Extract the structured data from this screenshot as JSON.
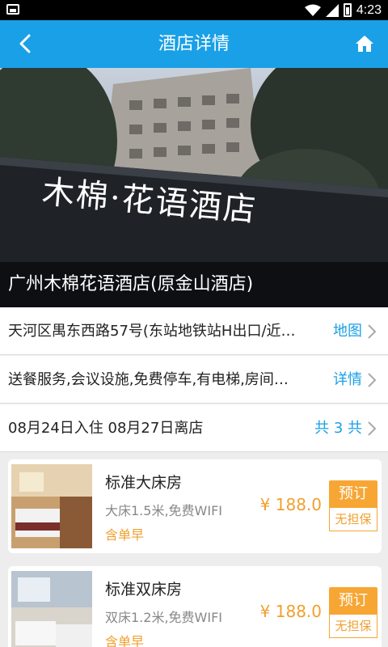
{
  "status_bar": {
    "time": "4:23"
  },
  "app_bar": {
    "title": "酒店详情"
  },
  "hotel": {
    "name": "广州木棉花语酒店(原金山酒店)",
    "sign_text": "木棉·花语酒店",
    "address": "天河区禺东西路57号(东站地铁站H出口/近…",
    "address_action": "地图",
    "facilities": "送餐服务,会议设施,免费停车,有电梯,房间…",
    "facilities_action": "详情",
    "stay": "08月24日入住 08月27日离店",
    "nights": "共 3 共"
  },
  "rooms": [
    {
      "name": "标准大床房",
      "bed": "大床1.5米,免费WIFI",
      "breakfast": "含单早",
      "price": "¥ 188.0",
      "book_label": "预订",
      "guarantee": "无担保"
    },
    {
      "name": "标准双床房",
      "bed": "双床1.2米,免费WIFI",
      "breakfast": "含单早",
      "price": "¥ 188.0",
      "book_label": "预订",
      "guarantee": "无担保"
    }
  ],
  "colors": {
    "primary": "#1aa0e6",
    "accent": "#f7a634"
  }
}
